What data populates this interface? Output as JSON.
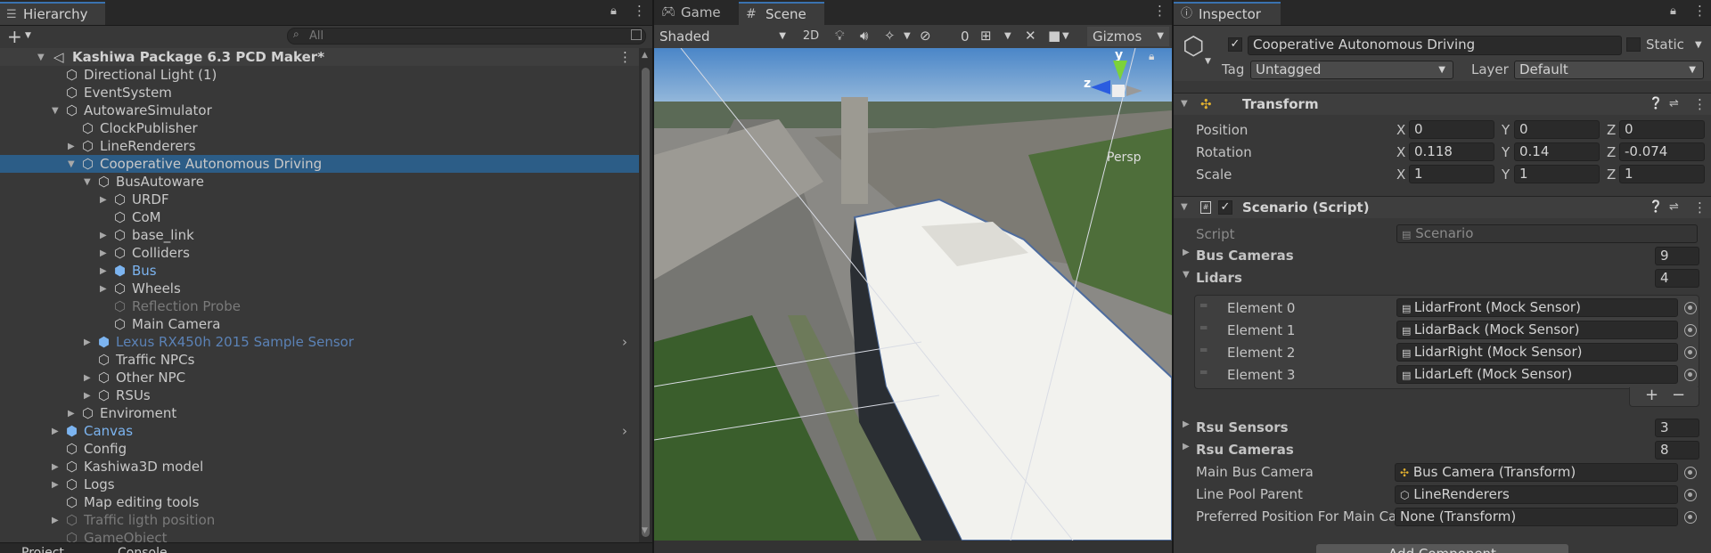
{
  "hierarchy": {
    "tab": "Hierarchy",
    "search_placeholder": "All",
    "add_label": "+",
    "scene_name": "Kashiwa Package 6.3 PCD Maker*",
    "items": [
      {
        "label": "Directional Light (1)",
        "state": "normal"
      },
      {
        "label": "EventSystem",
        "state": "normal"
      },
      {
        "label": "AutowareSimulator",
        "state": "normal"
      },
      {
        "label": "ClockPublisher",
        "state": "normal"
      },
      {
        "label": "LineRenderers",
        "state": "normal"
      },
      {
        "label": "Cooperative Autonomous Driving",
        "state": "selected"
      },
      {
        "label": "BusAutoware",
        "state": "normal"
      },
      {
        "label": "URDF",
        "state": "normal"
      },
      {
        "label": "CoM",
        "state": "normal"
      },
      {
        "label": "base_link",
        "state": "normal"
      },
      {
        "label": "Colliders",
        "state": "normal"
      },
      {
        "label": "Bus",
        "state": "prefab"
      },
      {
        "label": "Wheels",
        "state": "normal"
      },
      {
        "label": "Reflection Probe",
        "state": "disabled"
      },
      {
        "label": "Main Camera",
        "state": "normal"
      },
      {
        "label": "Lexus RX450h 2015 Sample Sensor",
        "state": "prefab-dim"
      },
      {
        "label": "Traffic NPCs",
        "state": "normal"
      },
      {
        "label": "Other NPC",
        "state": "normal"
      },
      {
        "label": "RSUs",
        "state": "normal"
      },
      {
        "label": "Enviroment",
        "state": "normal"
      },
      {
        "label": "Canvas",
        "state": "prefab"
      },
      {
        "label": "Config",
        "state": "normal"
      },
      {
        "label": "Kashiwa3D model",
        "state": "normal"
      },
      {
        "label": "Logs",
        "state": "normal"
      },
      {
        "label": "Map editing tools",
        "state": "normal"
      },
      {
        "label": "Traffic ligth position",
        "state": "disabled"
      },
      {
        "label": "GameObject",
        "state": "disabled"
      }
    ]
  },
  "bottom_tabs": [
    "Project",
    "Console"
  ],
  "scene": {
    "tab_game": "Game",
    "tab_scene": "Scene",
    "shading_mode": "Shaded",
    "mode_2d": "2D",
    "hidden_count": "0",
    "gizmos": "Gizmos",
    "projection": "Persp",
    "axis_y": "y",
    "axis_z": "z"
  },
  "inspector": {
    "tab": "Inspector",
    "object_name": "Cooperative Autonomous Driving",
    "static_label": "Static",
    "tag_label": "Tag",
    "tag_value": "Untagged",
    "layer_label": "Layer",
    "layer_value": "Default",
    "transform": {
      "title": "Transform",
      "position": {
        "label": "Position",
        "x": "0",
        "y": "0",
        "z": "0"
      },
      "rotation": {
        "label": "Rotation",
        "x": "0.118",
        "y": "0.14",
        "z": "-0.074"
      },
      "scale": {
        "label": "Scale",
        "x": "1",
        "y": "1",
        "z": "1"
      }
    },
    "scenario": {
      "title": "Scenario (Script)",
      "script_label": "Script",
      "script_value": "Scenario",
      "bus_cameras_label": "Bus Cameras",
      "bus_cameras_count": "9",
      "lidars_label": "Lidars",
      "lidars_count": "4",
      "lidar_elements": [
        {
          "label": "Element 0",
          "value": "LidarFront (Mock Sensor)"
        },
        {
          "label": "Element 1",
          "value": "LidarBack (Mock Sensor)"
        },
        {
          "label": "Element 2",
          "value": "LidarRight (Mock Sensor)"
        },
        {
          "label": "Element 3",
          "value": "LidarLeft (Mock Sensor)"
        }
      ],
      "rsu_sensors_label": "Rsu Sensors",
      "rsu_sensors_count": "3",
      "rsu_cameras_label": "Rsu Cameras",
      "rsu_cameras_count": "8",
      "main_bus_camera_label": "Main Bus Camera",
      "main_bus_camera_value": "Bus Camera  (Transform)",
      "line_pool_parent_label": "Line Pool Parent",
      "line_pool_parent_value": "LineRenderers",
      "preferred_position_label": "Preferred Position For Main Ca",
      "preferred_position_value": "None (Transform)"
    },
    "add_component": "Add Component"
  },
  "colors": {
    "selection": "#2c5d87",
    "prefab": "#7cb4f0",
    "accent": "#3a72b0"
  }
}
